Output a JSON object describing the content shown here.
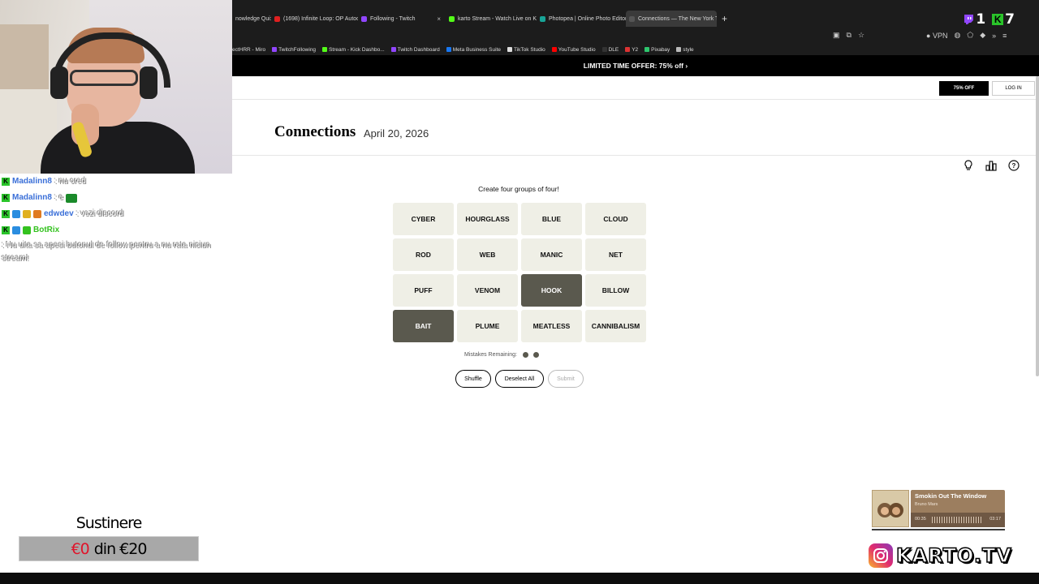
{
  "browser": {
    "tabs": [
      {
        "label": "nowledge Qui:",
        "color": "#888888"
      },
      {
        "label": "(1698) Infinite Loop: OP Autoca",
        "color": "#e02020"
      },
      {
        "label": "Following - Twitch",
        "color": "#9146ff"
      },
      {
        "label": "karto Stream - Watch Live on K",
        "color": "#53fc18"
      },
      {
        "label": "Photopea | Online Photo Editor",
        "color": "#18a497"
      },
      {
        "label": "Connections — The New York T",
        "color": "#555555",
        "active": true
      }
    ],
    "new_tab": "+",
    "twitch_count": "1",
    "kick_count": "7",
    "vpn_label": "VPN",
    "bookmarks": [
      {
        "label": "ectHRR - Miro",
        "color": "#f5d000"
      },
      {
        "label": "TwitchFollowing",
        "color": "#9146ff"
      },
      {
        "label": "Stream - Kick Dashbo...",
        "color": "#53fc18"
      },
      {
        "label": "Twitch Dashboard",
        "color": "#9146ff"
      },
      {
        "label": "Meta Business Suite",
        "color": "#1877f2"
      },
      {
        "label": "TikTok Studio",
        "color": "#dddddd"
      },
      {
        "label": "YouTube Studio",
        "color": "#ff0000"
      },
      {
        "label": "DLE",
        "color": "#333333"
      },
      {
        "label": "Y2",
        "color": "#d33"
      },
      {
        "label": "Pixabay",
        "color": "#2ec66d"
      },
      {
        "label": "style",
        "color": "#bbbbbb"
      }
    ],
    "offer_banner": "LIMITED TIME OFFER: 75% off ›"
  },
  "page": {
    "offer_button": "75% OFF",
    "login_button": "LOG IN",
    "title": "Connections",
    "date": "April 20, 2026",
    "instruction": "Create four groups of four!",
    "tiles": [
      {
        "label": "CYBER",
        "selected": false
      },
      {
        "label": "HOURGLASS",
        "selected": false
      },
      {
        "label": "BLUE",
        "selected": false
      },
      {
        "label": "CLOUD",
        "selected": false
      },
      {
        "label": "ROD",
        "selected": false
      },
      {
        "label": "WEB",
        "selected": false
      },
      {
        "label": "MANIC",
        "selected": false
      },
      {
        "label": "NET",
        "selected": false
      },
      {
        "label": "PUFF",
        "selected": false
      },
      {
        "label": "VENOM",
        "selected": false
      },
      {
        "label": "HOOK",
        "selected": true
      },
      {
        "label": "BILLOW",
        "selected": false
      },
      {
        "label": "BAIT",
        "selected": true
      },
      {
        "label": "PLUME",
        "selected": false
      },
      {
        "label": "MEATLESS",
        "selected": false
      },
      {
        "label": "CANNIBALISM",
        "selected": false
      }
    ],
    "mistakes_label": "Mistakes Remaining:",
    "mistakes_remaining": 2,
    "shuffle_button": "Shuffle",
    "deselect_button": "Deselect All",
    "submit_button": "Submit"
  },
  "stream": {
    "chat": [
      {
        "user": "Madalinn8",
        "color": "#3a6fd8",
        "message": ": nu cred"
      },
      {
        "user": "Madalinn8",
        "color": "#3a6fd8",
        "message": ": e"
      },
      {
        "user": "edwdev",
        "color": "#3a6fd8",
        "message": ": vezi discord"
      },
      {
        "user": "BotRix",
        "color": "#34c21f",
        "message": ": Nu uita sa apesi butonul de follow pentru a nu rata niciun stream!"
      }
    ],
    "support_title": "Sustinere",
    "support_current": "€0",
    "support_goal": "din €20",
    "now_playing_title": "Smokin Out The Window",
    "now_playing_artist": "Bruno Mars",
    "time_elapsed": "00:35",
    "time_total": "03:17",
    "brand": "KARTO.TV"
  }
}
